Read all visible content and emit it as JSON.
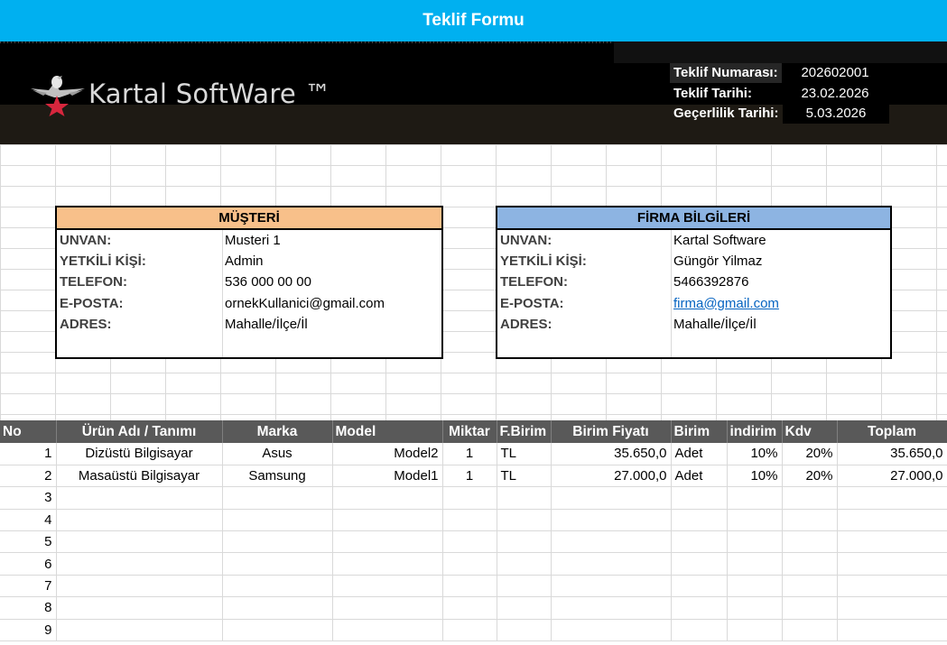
{
  "title": "Teklif Formu",
  "logo": {
    "text": "Kartal SoftWare ™",
    "icon": "eagle-star-icon"
  },
  "offer": {
    "number_label": "Teklif Numarası:",
    "number_value": "202602001",
    "date_label": "Teklif Tarihi:",
    "date_value": "23.02.2026",
    "validity_label": "Geçerlilik Tarihi:",
    "validity_value": "5.03.2026"
  },
  "customer": {
    "heading": "MÜŞTERİ",
    "rows": [
      {
        "key": "UNVAN:",
        "value": "Musteri 1"
      },
      {
        "key": "YETKİLİ KİŞİ:",
        "value": "Admin"
      },
      {
        "key": "TELEFON:",
        "value": "536 000 00 00"
      },
      {
        "key": "E-POSTA:",
        "value": "ornekKullanici@gmail.com"
      },
      {
        "key": "ADRES:",
        "value": "Mahalle/İlçe/İl"
      }
    ]
  },
  "company": {
    "heading": "FİRMA BİLGİLERİ",
    "rows": [
      {
        "key": "UNVAN:",
        "value": "Kartal Software"
      },
      {
        "key": "YETKİLİ KİŞİ:",
        "value": "Güngör Yilmaz"
      },
      {
        "key": "TELEFON:",
        "value": "5466392876"
      },
      {
        "key": "E-POSTA:",
        "value": "firma@gmail.com"
      },
      {
        "key": "ADRES:",
        "value": "Mahalle/İlçe/İl"
      }
    ]
  },
  "table": {
    "headers": [
      "No",
      "Ürün Adı / Tanımı",
      "Marka",
      "Model",
      "Miktar",
      "F.Birim",
      "Birim Fiyatı",
      "Birim",
      "indirim",
      "Kdv",
      "Toplam"
    ],
    "rows": [
      [
        "1",
        "Dizüstü Bilgisayar",
        "Asus",
        "Model2",
        "1",
        "TL",
        "35.650,0",
        "Adet",
        "10%",
        "20%",
        "35.650,0"
      ],
      [
        "2",
        "Masaüstü Bilgisayar",
        "Samsung",
        "Model1",
        "1",
        "TL",
        "27.000,0",
        "Adet",
        "10%",
        "20%",
        "27.000,0"
      ],
      [
        "3",
        "",
        "",
        "",
        "",
        "",
        "",
        "",
        "",
        "",
        ""
      ],
      [
        "4",
        "",
        "",
        "",
        "",
        "",
        "",
        "",
        "",
        "",
        ""
      ],
      [
        "5",
        "",
        "",
        "",
        "",
        "",
        "",
        "",
        "",
        "",
        ""
      ],
      [
        "6",
        "",
        "",
        "",
        "",
        "",
        "",
        "",
        "",
        "",
        ""
      ],
      [
        "7",
        "",
        "",
        "",
        "",
        "",
        "",
        "",
        "",
        "",
        ""
      ],
      [
        "8",
        "",
        "",
        "",
        "",
        "",
        "",
        "",
        "",
        "",
        ""
      ],
      [
        "9",
        "",
        "",
        "",
        "",
        "",
        "",
        "",
        "",
        "",
        ""
      ]
    ]
  },
  "colors": {
    "title_bar": "#00b0f0",
    "customer_header": "#f8c08a",
    "company_header": "#8db4e2",
    "table_header": "#595959",
    "link": "#0563c1"
  }
}
